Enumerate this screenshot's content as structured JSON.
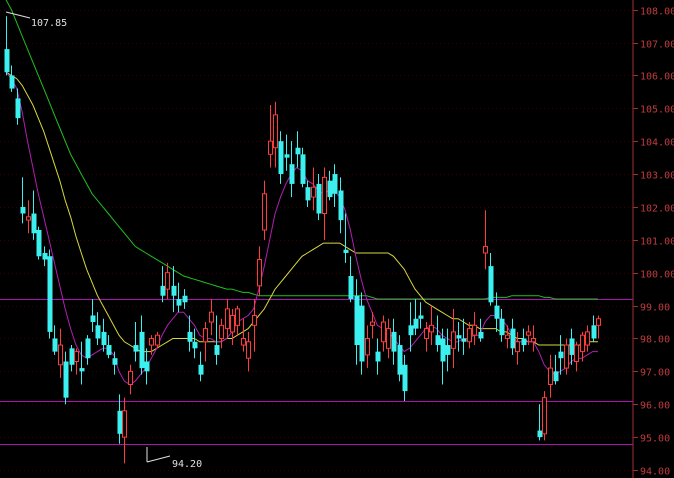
{
  "chart_data": {
    "type": "candlestick",
    "ylim": [
      94.0,
      108.05
    ],
    "y_ticks": [
      "108.00",
      "107.00",
      "106.00",
      "105.00",
      "104.00",
      "103.00",
      "102.00",
      "101.00",
      "100.00",
      "99.00",
      "98.00",
      "97.00",
      "96.00",
      "95.00",
      "94.00"
    ],
    "annotations": {
      "high_label": "107.85",
      "low_label": "94.20"
    },
    "horizontal_lines": [
      99.2,
      96.1,
      94.8
    ],
    "candles": [
      [
        106.8,
        107.8,
        106.0,
        106.1
      ],
      [
        106.0,
        106.3,
        105.5,
        105.6
      ],
      [
        105.3,
        105.6,
        104.5,
        104.7
      ],
      [
        102.0,
        102.9,
        101.5,
        101.8
      ],
      [
        101.6,
        102.2,
        101.2,
        101.7
      ],
      [
        101.8,
        102.5,
        101.0,
        101.2
      ],
      [
        101.3,
        101.4,
        100.4,
        100.5
      ],
      [
        100.6,
        100.8,
        100.2,
        100.4
      ],
      [
        100.5,
        100.7,
        98.0,
        98.2
      ],
      [
        98.0,
        98.4,
        97.5,
        97.6
      ],
      [
        97.2,
        98.3,
        96.8,
        97.8
      ],
      [
        97.3,
        97.6,
        96.0,
        96.2
      ],
      [
        97.7,
        97.8,
        97.0,
        97.2
      ],
      [
        97.3,
        97.7,
        96.9,
        97.6
      ],
      [
        97.1,
        97.9,
        96.6,
        97.0
      ],
      [
        98.0,
        98.1,
        97.2,
        97.4
      ],
      [
        98.7,
        99.2,
        98.2,
        98.5
      ],
      [
        98.4,
        98.8,
        97.8,
        98.0
      ],
      [
        98.2,
        98.6,
        97.6,
        97.8
      ],
      [
        97.8,
        98.1,
        97.4,
        97.5
      ],
      [
        97.4,
        97.6,
        96.9,
        97.2
      ],
      [
        95.8,
        96.3,
        94.8,
        95.1
      ],
      [
        95.0,
        96.2,
        94.2,
        95.8
      ],
      [
        96.6,
        97.2,
        96.3,
        97.0
      ],
      [
        97.8,
        98.5,
        97.3,
        97.6
      ],
      [
        98.2,
        98.7,
        96.9,
        97.1
      ],
      [
        97.3,
        97.7,
        96.6,
        97.0
      ],
      [
        97.8,
        98.1,
        97.5,
        98.0
      ],
      [
        97.8,
        98.2,
        97.7,
        98.1
      ],
      [
        99.6,
        100.2,
        99.1,
        99.3
      ],
      [
        99.5,
        100.3,
        99.2,
        100.0
      ],
      [
        99.6,
        100.2,
        98.8,
        99.3
      ],
      [
        99.2,
        99.7,
        98.8,
        99.0
      ],
      [
        99.3,
        99.5,
        98.9,
        99.1
      ],
      [
        98.2,
        98.7,
        97.6,
        97.9
      ],
      [
        97.9,
        98.3,
        97.4,
        97.7
      ],
      [
        97.2,
        97.6,
        96.7,
        96.9
      ],
      [
        97.9,
        98.5,
        97.3,
        98.3
      ],
      [
        98.5,
        99.2,
        98.1,
        98.8
      ],
      [
        97.8,
        98.7,
        97.2,
        97.5
      ],
      [
        98.0,
        98.6,
        97.7,
        98.4
      ],
      [
        98.3,
        99.2,
        98.0,
        98.9
      ],
      [
        98.2,
        98.9,
        97.8,
        98.7
      ],
      [
        98.4,
        99.0,
        98.1,
        98.9
      ],
      [
        97.8,
        98.6,
        97.6,
        98.0
      ],
      [
        97.4,
        98.2,
        97.0,
        97.9
      ],
      [
        98.4,
        99.2,
        97.6,
        98.7
      ],
      [
        99.6,
        100.8,
        99.3,
        100.4
      ],
      [
        101.3,
        102.8,
        101.0,
        102.4
      ],
      [
        103.6,
        105.1,
        103.2,
        104.0
      ],
      [
        103.8,
        105.2,
        103.2,
        104.8
      ],
      [
        104.0,
        104.3,
        102.7,
        103.0
      ],
      [
        103.6,
        104.2,
        103.1,
        103.5
      ],
      [
        103.3,
        104.0,
        102.3,
        102.7
      ],
      [
        103.8,
        104.3,
        103.2,
        103.6
      ],
      [
        103.6,
        103.8,
        102.6,
        102.7
      ],
      [
        102.6,
        102.8,
        102.0,
        102.2
      ],
      [
        102.3,
        103.2,
        101.9,
        102.6
      ],
      [
        102.7,
        103.0,
        101.6,
        101.8
      ],
      [
        101.8,
        103.2,
        101.0,
        102.9
      ],
      [
        102.8,
        103.1,
        102.2,
        102.3
      ],
      [
        103.0,
        103.3,
        102.0,
        102.4
      ],
      [
        102.5,
        102.9,
        101.2,
        101.6
      ],
      [
        100.7,
        101.8,
        100.3,
        100.6
      ],
      [
        99.9,
        100.5,
        99.1,
        99.2
      ],
      [
        99.3,
        99.8,
        97.2,
        97.8
      ],
      [
        99.0,
        99.4,
        96.9,
        97.3
      ],
      [
        97.5,
        98.4,
        97.1,
        98.0
      ],
      [
        98.4,
        98.8,
        98.0,
        98.5
      ],
      [
        97.6,
        98.0,
        96.9,
        97.3
      ],
      [
        97.9,
        98.7,
        97.6,
        98.5
      ],
      [
        97.7,
        98.6,
        97.4,
        98.3
      ],
      [
        98.2,
        98.6,
        97.2,
        97.6
      ],
      [
        97.8,
        98.1,
        96.7,
        96.9
      ],
      [
        97.2,
        97.5,
        96.1,
        96.4
      ],
      [
        98.4,
        99.1,
        97.6,
        98.1
      ],
      [
        98.6,
        99.2,
        98.1,
        98.3
      ],
      [
        98.7,
        99.1,
        98.3,
        98.6
      ],
      [
        98.0,
        98.5,
        97.6,
        98.3
      ],
      [
        98.2,
        99.0,
        97.8,
        98.4
      ],
      [
        98.1,
        98.7,
        97.6,
        97.8
      ],
      [
        98.0,
        98.3,
        96.6,
        97.3
      ],
      [
        97.8,
        98.3,
        97.0,
        97.5
      ],
      [
        97.7,
        98.9,
        97.1,
        98.2
      ],
      [
        98.1,
        98.5,
        97.6,
        98.0
      ],
      [
        98.0,
        98.6,
        97.5,
        97.9
      ],
      [
        97.9,
        98.5,
        97.7,
        98.3
      ],
      [
        98.1,
        98.8,
        97.8,
        98.4
      ],
      [
        98.2,
        98.6,
        97.9,
        98.0
      ],
      [
        100.6,
        101.9,
        100.1,
        100.8
      ],
      [
        100.2,
        100.6,
        99.0,
        99.1
      ],
      [
        99.0,
        99.4,
        98.2,
        98.6
      ],
      [
        98.6,
        98.9,
        97.9,
        98.1
      ],
      [
        98.0,
        98.4,
        97.7,
        98.1
      ],
      [
        98.3,
        98.6,
        97.5,
        97.7
      ],
      [
        97.6,
        98.2,
        97.2,
        97.9
      ],
      [
        98.0,
        98.3,
        97.6,
        97.8
      ],
      [
        98.1,
        98.4,
        97.8,
        98.2
      ],
      [
        97.9,
        98.4,
        97.6,
        98.0
      ],
      [
        95.2,
        96.0,
        94.9,
        95.0
      ],
      [
        95.1,
        96.4,
        94.9,
        96.2
      ],
      [
        96.6,
        97.5,
        96.2,
        97.1
      ],
      [
        97.0,
        97.5,
        96.6,
        96.7
      ],
      [
        97.6,
        98.1,
        96.9,
        97.4
      ],
      [
        97.1,
        98.0,
        96.9,
        97.8
      ],
      [
        98.0,
        98.3,
        97.2,
        97.5
      ],
      [
        97.3,
        97.9,
        97.0,
        97.8
      ],
      [
        97.6,
        98.2,
        97.3,
        98.1
      ],
      [
        97.8,
        98.4,
        97.6,
        98.2
      ],
      [
        98.4,
        98.7,
        97.9,
        98.0
      ],
      [
        98.4,
        98.7,
        98.0,
        98.6
      ]
    ],
    "ma_short": [
      106.1,
      105.9,
      105.6,
      104.9,
      104.0,
      103.2,
      102.4,
      101.7,
      101.0,
      100.3,
      99.6,
      98.9,
      98.3,
      97.8,
      97.5,
      97.4,
      97.5,
      97.6,
      97.7,
      97.7,
      97.5,
      97.0,
      96.7,
      96.6,
      96.7,
      96.9,
      97.1,
      97.4,
      97.7,
      98.1,
      98.4,
      98.6,
      98.8,
      98.8,
      98.6,
      98.4,
      98.1,
      98.0,
      98.0,
      97.9,
      97.9,
      98.0,
      98.2,
      98.5,
      98.6,
      98.7,
      98.9,
      99.5,
      100.2,
      101.0,
      101.8,
      102.3,
      102.7,
      103.0,
      103.2,
      103.1,
      102.8,
      102.7,
      102.5,
      102.4,
      102.5,
      102.5,
      102.3,
      101.9,
      101.3,
      100.5,
      99.8,
      99.2,
      98.8,
      98.4,
      98.3,
      98.2,
      98.0,
      97.8,
      97.6,
      97.7,
      97.9,
      98.1,
      98.3,
      98.4,
      98.3,
      98.1,
      98.0,
      97.9,
      97.9,
      98.0,
      98.0,
      98.1,
      98.1,
      98.5,
      98.7,
      98.7,
      98.6,
      98.4,
      98.1,
      97.9,
      97.9,
      97.9,
      97.9,
      97.6,
      97.2,
      97.0,
      96.9,
      97.0,
      97.1,
      97.3,
      97.4,
      97.4,
      97.5,
      97.6,
      97.6
    ],
    "ma_mid": [
      106.1,
      106.0,
      105.9,
      105.7,
      105.4,
      105.1,
      104.7,
      104.3,
      103.8,
      103.3,
      102.8,
      102.2,
      101.7,
      101.1,
      100.6,
      100.1,
      99.7,
      99.3,
      99.0,
      98.7,
      98.4,
      98.1,
      97.9,
      97.8,
      97.7,
      97.6,
      97.6,
      97.6,
      97.7,
      97.8,
      97.9,
      98.0,
      98.0,
      98.0,
      98.0,
      98.0,
      97.9,
      97.9,
      97.9,
      97.9,
      97.9,
      98.0,
      98.0,
      98.1,
      98.2,
      98.3,
      98.5,
      98.7,
      98.9,
      99.2,
      99.5,
      99.7,
      99.9,
      100.1,
      100.3,
      100.5,
      100.6,
      100.7,
      100.8,
      100.9,
      100.9,
      100.9,
      100.9,
      100.8,
      100.7,
      100.6,
      100.6,
      100.6,
      100.6,
      100.6,
      100.6,
      100.6,
      100.5,
      100.3,
      100.1,
      99.8,
      99.5,
      99.3,
      99.1,
      99.0,
      98.9,
      98.8,
      98.7,
      98.6,
      98.6,
      98.5,
      98.4,
      98.4,
      98.3,
      98.3,
      98.3,
      98.3,
      98.2,
      98.2,
      98.1,
      98.0,
      98.0,
      97.9,
      97.9,
      97.8,
      97.8,
      97.8,
      97.8,
      97.8,
      97.8,
      97.8,
      97.8,
      97.8,
      97.9,
      97.9,
      97.9
    ],
    "ma_long": [
      108.3,
      108.0,
      107.6,
      107.2,
      106.8,
      106.4,
      106.0,
      105.6,
      105.2,
      104.8,
      104.4,
      104.0,
      103.6,
      103.3,
      103.0,
      102.7,
      102.4,
      102.2,
      102.0,
      101.8,
      101.6,
      101.4,
      101.2,
      101.0,
      100.8,
      100.7,
      100.6,
      100.5,
      100.4,
      100.3,
      100.2,
      100.1,
      100.0,
      99.9,
      99.85,
      99.8,
      99.75,
      99.7,
      99.65,
      99.6,
      99.55,
      99.5,
      99.5,
      99.45,
      99.4,
      99.4,
      99.35,
      99.3,
      99.3,
      99.3,
      99.3,
      99.3,
      99.3,
      99.3,
      99.3,
      99.3,
      99.3,
      99.3,
      99.3,
      99.3,
      99.3,
      99.3,
      99.3,
      99.3,
      99.3,
      99.3,
      99.3,
      99.3,
      99.25,
      99.2,
      99.2,
      99.2,
      99.2,
      99.2,
      99.2,
      99.2,
      99.2,
      99.2,
      99.2,
      99.2,
      99.2,
      99.2,
      99.2,
      99.2,
      99.2,
      99.2,
      99.2,
      99.2,
      99.2,
      99.2,
      99.25,
      99.25,
      99.25,
      99.25,
      99.3,
      99.3,
      99.3,
      99.3,
      99.3,
      99.3,
      99.25,
      99.25,
      99.2,
      99.2,
      99.2,
      99.2,
      99.2,
      99.2,
      99.2,
      99.2,
      99.2
    ]
  }
}
